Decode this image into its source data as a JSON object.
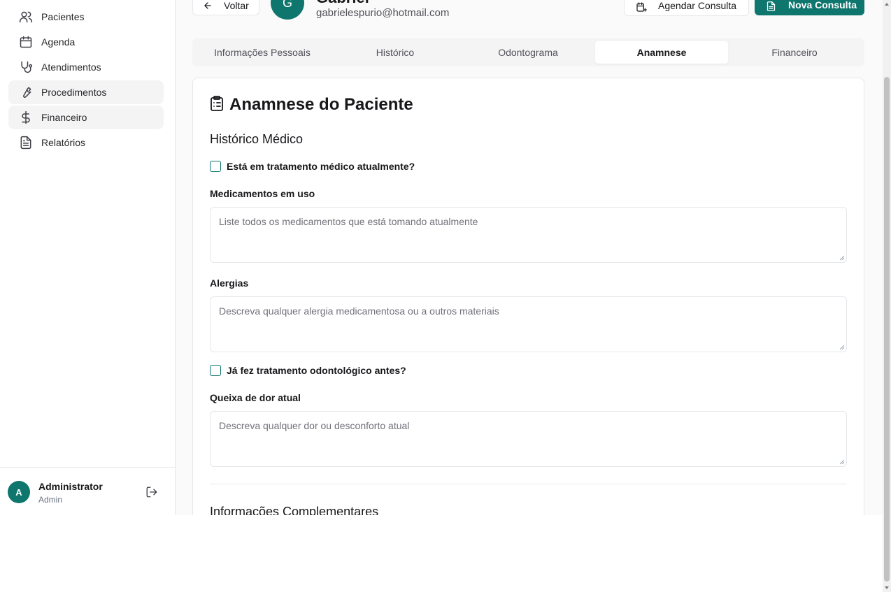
{
  "sidebar": {
    "items": [
      {
        "label": "Pacientes",
        "icon": "users-icon"
      },
      {
        "label": "Agenda",
        "icon": "calendar-icon"
      },
      {
        "label": "Atendimentos",
        "icon": "stethoscope-icon"
      },
      {
        "label": "Procedimentos",
        "icon": "wrench-icon"
      },
      {
        "label": "Financeiro",
        "icon": "dollar-icon"
      },
      {
        "label": "Relatórios",
        "icon": "file-text-icon"
      }
    ],
    "user": {
      "initial": "A",
      "name": "Administrator",
      "role": "Admin"
    }
  },
  "header": {
    "back_label": "Voltar",
    "avatar_initial": "G",
    "patient_name": "Gabriel",
    "patient_email": "gabrielespurio@hotmail.com",
    "schedule_label": "Agendar Consulta",
    "new_consult_label": "Nova Consulta"
  },
  "tabs": [
    {
      "label": "Informações Pessoais",
      "active": false
    },
    {
      "label": "Histórico",
      "active": false
    },
    {
      "label": "Odontograma",
      "active": false
    },
    {
      "label": "Anamnese",
      "active": true
    },
    {
      "label": "Financeiro",
      "active": false
    }
  ],
  "card": {
    "title": "Anamnese do Paciente",
    "section_medical": "Histórico Médico",
    "check_treatment": "Está em tratamento médico atualmente?",
    "medications_label": "Medicamentos em uso",
    "medications_placeholder": "Liste todos os medicamentos que está tomando atualmente",
    "allergies_label": "Alergias",
    "allergies_placeholder": "Descreva qualquer alergia medicamentosa ou a outros materiais",
    "check_dental": "Já fez tratamento odontológico antes?",
    "pain_label": "Queixa de dor atual",
    "pain_placeholder": "Descreva qualquer dor ou desconforto atual",
    "section_complementary": "Informações Complementares"
  },
  "colors": {
    "accent": "#0f766e",
    "border": "#e5e7eb",
    "muted_bg": "#f4f4f5"
  }
}
